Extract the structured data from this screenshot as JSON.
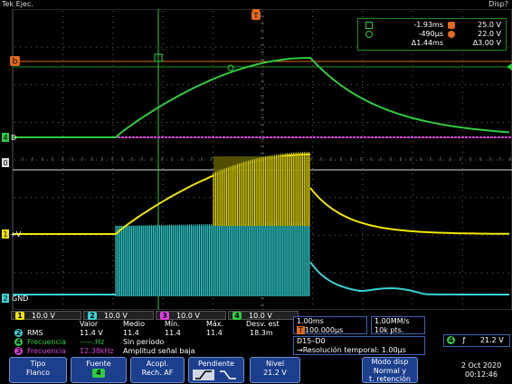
{
  "status": {
    "brand": "Tek",
    "mode": "Ejec.",
    "right": "Disp?"
  },
  "cursors": {
    "t1": "-1.93ms",
    "t2": "-490µs",
    "dt": "Δ1.44ms",
    "v1": "25.0 V",
    "v2": "22.0 V",
    "dv": "Δ3.00 V",
    "b_label": "B"
  },
  "markers": {
    "trigger_pos": "T",
    "b_cursor": "b",
    "d_label": "D",
    "zero_label": "0",
    "ch1_label": "1",
    "ch1_v": "+V",
    "ch2_label": "2",
    "ch2_gnd": "GND",
    "ch4_label": "4"
  },
  "channels": [
    {
      "num": "1",
      "scale": "10.0 V",
      "color": "#f2e600"
    },
    {
      "num": "2",
      "scale": "10.0 V",
      "color": "#39d3d3"
    },
    {
      "num": "3",
      "scale": "10.0 V",
      "color": "#e040e0"
    },
    {
      "num": "4",
      "scale": "10.0 V",
      "color": "#2ecc40"
    }
  ],
  "measurements": {
    "headers": [
      "Valor",
      "Medio",
      "Mín.",
      "Máx.",
      "Desv. est"
    ],
    "rows": [
      {
        "ch": "2",
        "name": "RMS",
        "valor": "11.4 V",
        "medio": "11.4",
        "min": "11.4",
        "max": "11.4",
        "desv": "18.3m"
      },
      {
        "ch": "4",
        "name": "Frecuencia",
        "valor": "-----.Hz",
        "note": "Sin período"
      },
      {
        "ch": "3",
        "name": "Frecuencia",
        "valor": "12.38kHz",
        "note": "Amplitud señal baja"
      }
    ]
  },
  "timebase": {
    "scale": "1.00ms",
    "position": "100.000µs",
    "rate": "1.00MM/s",
    "points": "10k pts."
  },
  "digital": {
    "range": "D15–D0",
    "resolution": "→Resolución temporal: 1.00µs"
  },
  "trigger": {
    "ch": "4",
    "slope": "ƒ",
    "level": "21.2 V"
  },
  "softkeys": {
    "tipo": {
      "label": "Tipo",
      "value": "Flanco"
    },
    "fuente": {
      "label": "Fuente",
      "value": "4"
    },
    "acopl": {
      "label": "Acopl.",
      "value": "Rech. AF"
    },
    "pendiente": {
      "label": "Pendiente"
    },
    "nivel": {
      "label": "Nivel",
      "value": "21.2 V"
    },
    "modo": {
      "label": "Modo disp",
      "value1": "Normal y",
      "value2": "t. retención"
    }
  },
  "datetime": {
    "date": "2 Oct  2020",
    "time": "00:12:46"
  }
}
